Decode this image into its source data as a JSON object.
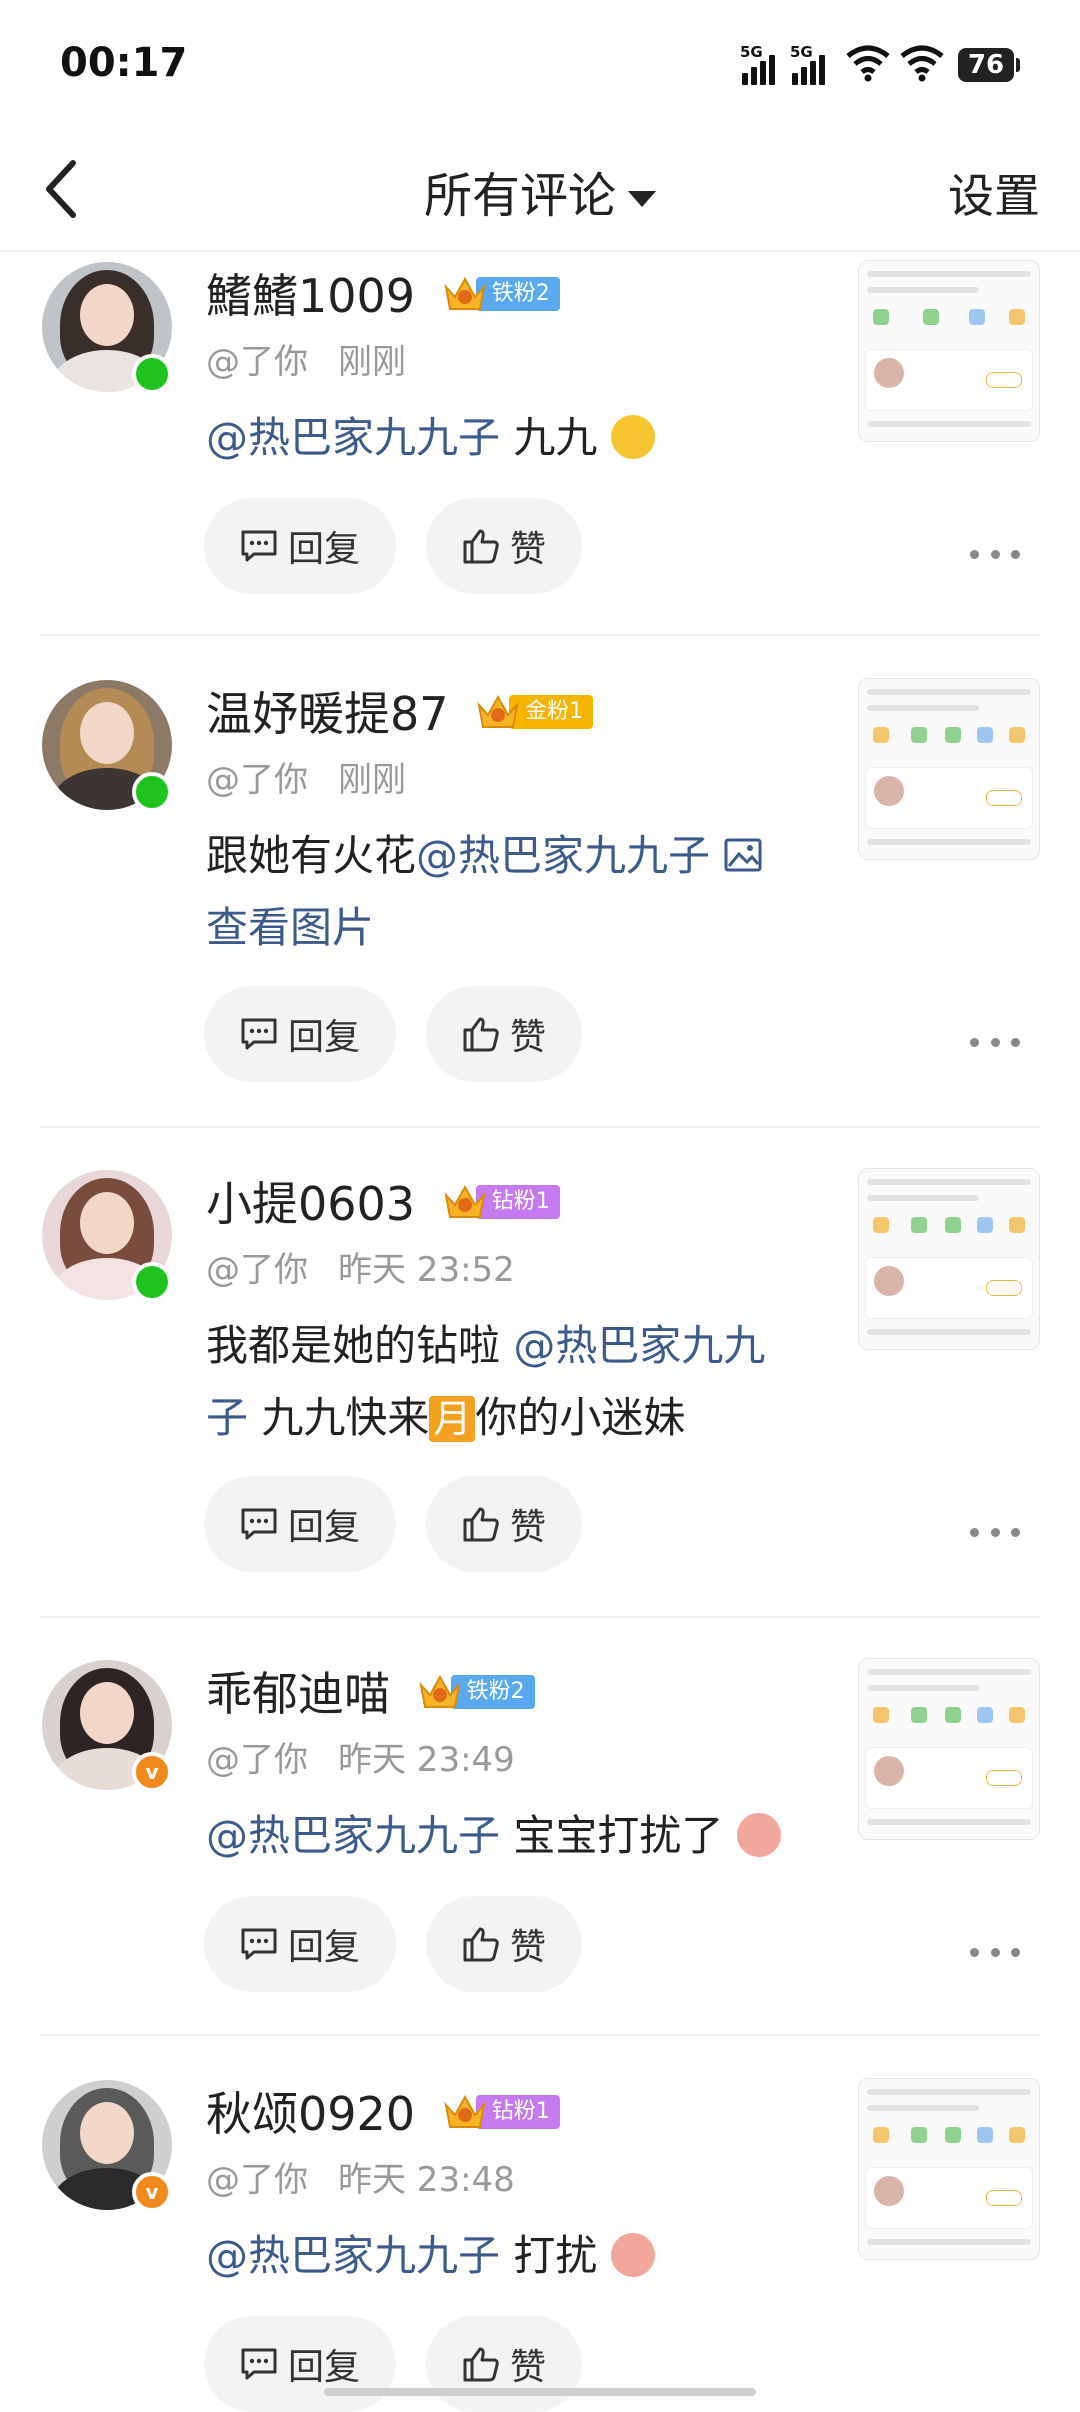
{
  "status_bar": {
    "time": "00:17",
    "signal1_label": "5G",
    "signal2_label": "5G",
    "battery": "76"
  },
  "nav": {
    "title": "所有评论",
    "settings": "设置"
  },
  "actions": {
    "reply": "回复",
    "like": "赞"
  },
  "comments": [
    {
      "username": "鰭鰭1009",
      "fan_label": "铁粉2",
      "mention_prefix": "@了你",
      "time": "刚刚",
      "mention": "@热巴家九九子",
      "text": " 九九"
    },
    {
      "username": "温妤暖提87",
      "fan_label": "金粉1",
      "mention_prefix": "@了你",
      "time": "刚刚",
      "text": "跟她有火花",
      "mention": "@热巴家九九子",
      "view_image": "查看图片"
    },
    {
      "username": "小提0603",
      "fan_label": "钻粉1",
      "mention_prefix": "@了你",
      "time": "昨天 23:52",
      "text": "我都是她的钻啦 ",
      "mention_a": "@热巴家九九",
      "mention_b": "子",
      "text_b": " 九九快来",
      "moon": "月",
      "text_c": "你的小迷妹"
    },
    {
      "username": "乖郁迪喵",
      "fan_label": "铁粉2",
      "mention_prefix": "@了你",
      "time": "昨天 23:49",
      "mention": "@热巴家九九子",
      "text": " 宝宝打扰了"
    },
    {
      "username": "秋颂0920",
      "fan_label": "钻粉1",
      "mention_prefix": "@了你",
      "time": "昨天 23:48",
      "mention": "@热巴家九九子",
      "text": " 打扰"
    }
  ],
  "colors": {
    "mention": "#3d5a8c",
    "iron_fan": "#5aa8f0",
    "gold_fan": "#f5b400",
    "diamond_fan": "#c57af0",
    "online": "#1fc21f",
    "verified": "#f08a1c"
  }
}
